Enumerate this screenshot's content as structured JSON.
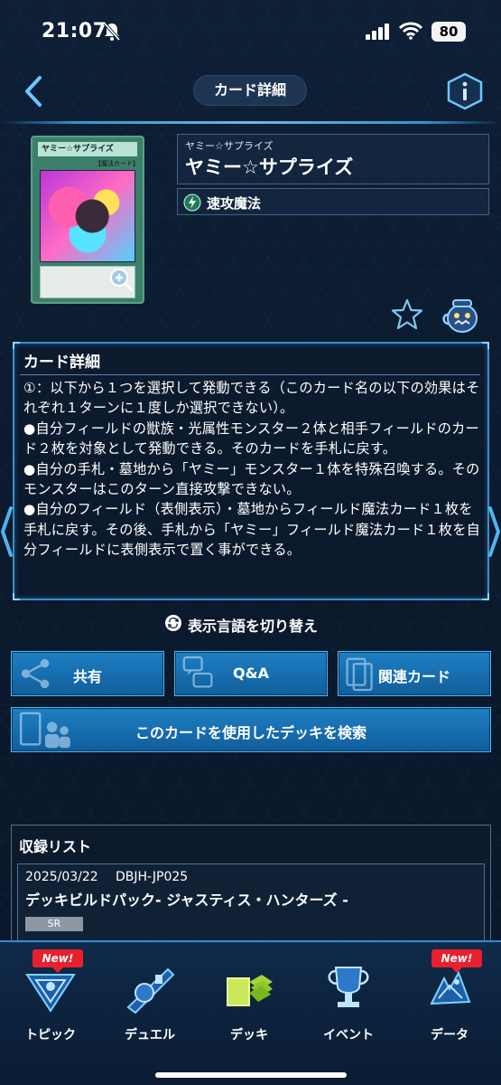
{
  "status_bar": {
    "time": "21:07",
    "battery": "80"
  },
  "header": {
    "title": "カード詳細"
  },
  "card": {
    "art_name": "ヤミー☆サプライズ",
    "art_type": "【魔法カード】",
    "ruby": "ヤミー☆サプライズ",
    "name": "ヤミー☆サプライズ",
    "type_label": "速攻魔法"
  },
  "detail": {
    "title": "カード詳細",
    "effect": "①：以下から１つを選択して発動できる（このカード名の以下の効果はそれぞれ１ターンに１度しか選択できない）。\n●自分フィールドの獣族・光属性モンスター２体と相手フィールドのカード２枚を対象として発動できる。そのカードを手札に戻す。\n●自分の手札・墓地から「ヤミー」モンスター１体を特殊召喚する。そのモンスターはこのターン直接攻撃できない。\n●自分のフィールド（表側表示）・墓地からフィールド魔法カード１枚を手札に戻す。その後、手札から「ヤミー」フィールド魔法カード１枚を自分フィールドに表側表示で置く事ができる。"
  },
  "lang_toggle": {
    "label": "表示言語を切り替え"
  },
  "buttons": {
    "share": "共有",
    "qa": "Q&A",
    "related": "関連カード",
    "deck_search": "このカードを使用したデッキを検索"
  },
  "recording": {
    "title": "収録リスト",
    "items": [
      {
        "date": "2025/03/22",
        "code": "DBJH-JP025",
        "name": "デッキビルドパック- ジャスティス・ハンターズ -",
        "rarity": "SR"
      }
    ]
  },
  "bottom_nav": {
    "new_badge": "New!",
    "items": [
      {
        "label": "トピック"
      },
      {
        "label": "デュエル"
      },
      {
        "label": "デッキ"
      },
      {
        "label": "イベント"
      },
      {
        "label": "データ"
      }
    ]
  },
  "colors": {
    "accent": "#3aa8e8",
    "button": "#1a76b8",
    "badge": "#e8202e"
  }
}
